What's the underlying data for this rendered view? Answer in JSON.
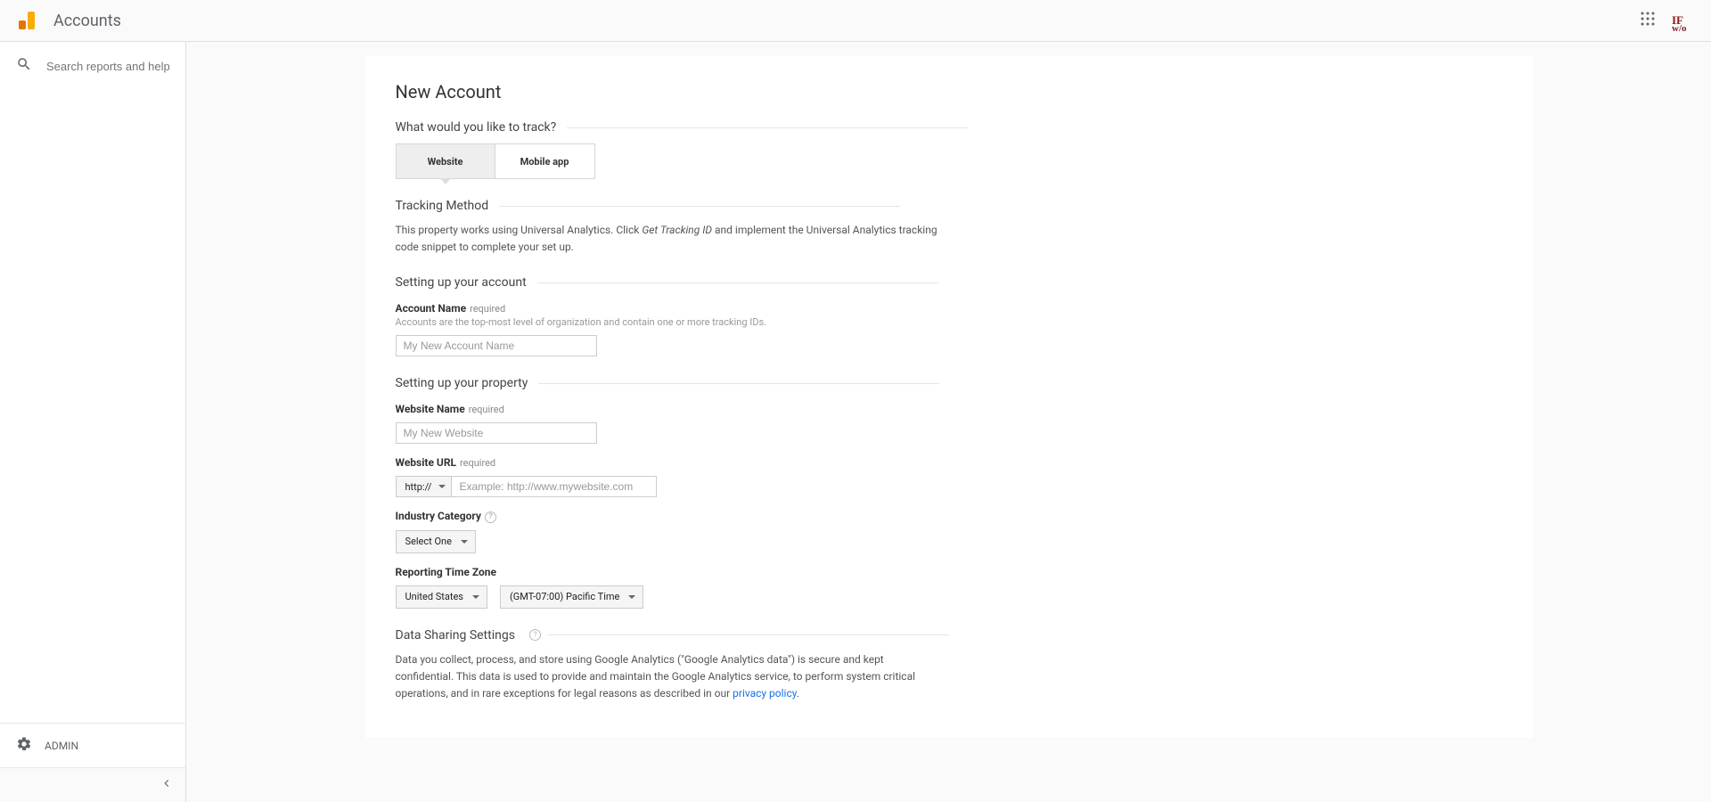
{
  "header": {
    "title": "Accounts"
  },
  "sidebar": {
    "search_placeholder": "Search reports and help",
    "admin_label": "ADMIN"
  },
  "page": {
    "title": "New Account",
    "track_section": "What would you like to track?",
    "tabs": {
      "website": "Website",
      "mobile": "Mobile app"
    },
    "method_section": "Tracking Method",
    "method_text_1": "This property works using Universal Analytics. Click ",
    "method_text_em": "Get Tracking ID",
    "method_text_2": " and implement the Universal Analytics tracking code snippet to complete your set up.",
    "account_section": "Setting up your account",
    "account_name_label": "Account Name",
    "required_label": "required",
    "account_help": "Accounts are the top-most level of organization and contain one or more tracking IDs.",
    "account_name_placeholder": "My New Account Name",
    "property_section": "Setting up your property",
    "website_name_label": "Website Name",
    "website_name_placeholder": "My New Website",
    "website_url_label": "Website URL",
    "protocol": "http://",
    "website_url_placeholder": "Example: http://www.mywebsite.com",
    "industry_label": "Industry Category",
    "industry_value": "Select One",
    "timezone_label": "Reporting Time Zone",
    "tz_country": "United States",
    "tz_value": "(GMT-07:00) Pacific Time",
    "sharing_section": "Data Sharing Settings",
    "sharing_text": "Data you collect, process, and store using Google Analytics (\"Google Analytics data\") is secure and kept confidential. This data is used to provide and maintain the Google Analytics service, to perform system critical operations, and in rare exceptions for legal reasons as described in our ",
    "sharing_link": "privacy policy"
  }
}
